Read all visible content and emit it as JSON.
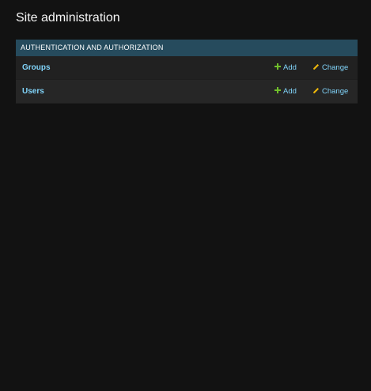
{
  "page": {
    "title": "Site administration"
  },
  "module": {
    "caption": "Authentication and Authorization",
    "rows": [
      {
        "name": "Groups",
        "add_label": "Add",
        "change_label": "Change"
      },
      {
        "name": "Users",
        "add_label": "Add",
        "change_label": "Change"
      }
    ]
  },
  "colors": {
    "background": "#121212",
    "caption_bg": "#264b5d",
    "link": "#81d4fa",
    "add_icon": "#70bf2b",
    "change_icon": "#efb80b"
  },
  "icons": {
    "add": "plus-icon",
    "change": "pencil-icon"
  }
}
